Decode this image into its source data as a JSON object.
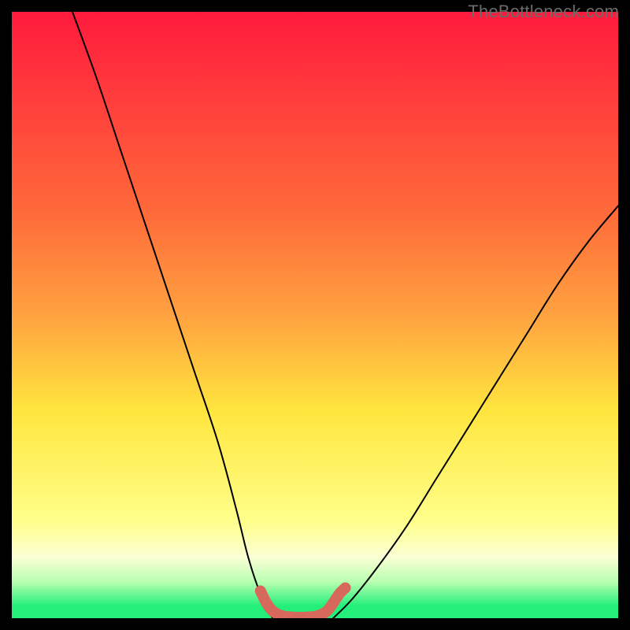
{
  "watermark": "TheBottleneck.com",
  "palette": {
    "red": "#ff1a3c",
    "orange_red": "#ff6a3a",
    "orange": "#ffa240",
    "yellow": "#ffe63e",
    "yellowsoft": "#ffff8a",
    "cream": "#fbffd5",
    "palegreen": "#b8ffb0",
    "green": "#23ef7a",
    "curve": "#000000",
    "accent": "#d6695a"
  },
  "chart_data": {
    "type": "line",
    "title": "",
    "xlabel": "",
    "ylabel": "",
    "xlim": [
      0,
      100
    ],
    "ylim": [
      0,
      100
    ],
    "series": [
      {
        "name": "left-curve",
        "x": [
          10,
          14,
          18,
          22,
          26,
          30,
          34,
          37,
          39,
          41,
          43
        ],
        "values": [
          100,
          89,
          77,
          65,
          53,
          41,
          29,
          18,
          10,
          4,
          0
        ]
      },
      {
        "name": "right-curve",
        "x": [
          53,
          56,
          60,
          65,
          70,
          75,
          80,
          85,
          90,
          95,
          100
        ],
        "values": [
          0,
          3,
          8,
          15,
          23,
          31,
          39,
          47,
          55,
          62,
          68
        ]
      },
      {
        "name": "valley-accent",
        "x": [
          41,
          42,
          43,
          44,
          45,
          46,
          47,
          48,
          49,
          50,
          51,
          52,
          53,
          54,
          55
        ],
        "values": [
          4.5,
          2.5,
          1.2,
          0.6,
          0.3,
          0.2,
          0.15,
          0.15,
          0.2,
          0.3,
          0.6,
          1.2,
          2.5,
          4.0,
          5.0
        ]
      }
    ],
    "gradient_stops": [
      {
        "pct": 0,
        "key": "red"
      },
      {
        "pct": 33,
        "key": "orange_red"
      },
      {
        "pct": 50,
        "key": "orange"
      },
      {
        "pct": 66,
        "key": "yellow"
      },
      {
        "pct": 84,
        "key": "yellowsoft"
      },
      {
        "pct": 90,
        "key": "cream"
      },
      {
        "pct": 94,
        "key": "palegreen"
      },
      {
        "pct": 98,
        "key": "green"
      },
      {
        "pct": 100,
        "key": "green"
      }
    ]
  }
}
